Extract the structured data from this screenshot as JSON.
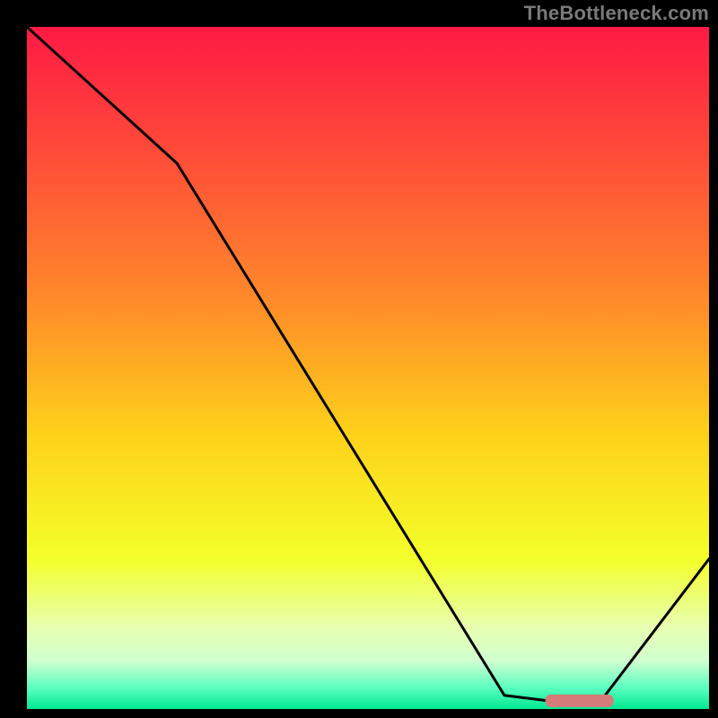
{
  "watermark": "TheBottleneck.com",
  "chart_data": {
    "type": "line",
    "title": "",
    "xlabel": "",
    "ylabel": "",
    "xlim": [
      0,
      100
    ],
    "ylim": [
      0,
      100
    ],
    "grid": false,
    "legend": false,
    "series": [
      {
        "name": "bottleneck-curve",
        "x": [
          0,
          22,
          70,
          78,
          84,
          100
        ],
        "values": [
          100,
          80,
          2,
          1,
          1,
          22
        ]
      }
    ],
    "marker": {
      "name": "optimal-range",
      "x_range": [
        76,
        86
      ],
      "y": 1.2,
      "color": "#d77a7a"
    },
    "background_gradient": {
      "stops": [
        {
          "offset": 0.0,
          "color": "#ff1a44"
        },
        {
          "offset": 0.18,
          "color": "#ff4a3a"
        },
        {
          "offset": 0.4,
          "color": "#ff8a2a"
        },
        {
          "offset": 0.6,
          "color": "#ffd21a"
        },
        {
          "offset": 0.78,
          "color": "#f3ff2a"
        },
        {
          "offset": 0.88,
          "color": "#e8ffb0"
        },
        {
          "offset": 0.93,
          "color": "#d0ffd0"
        },
        {
          "offset": 0.97,
          "color": "#58ffc0"
        },
        {
          "offset": 1.0,
          "color": "#00e890"
        }
      ]
    }
  }
}
